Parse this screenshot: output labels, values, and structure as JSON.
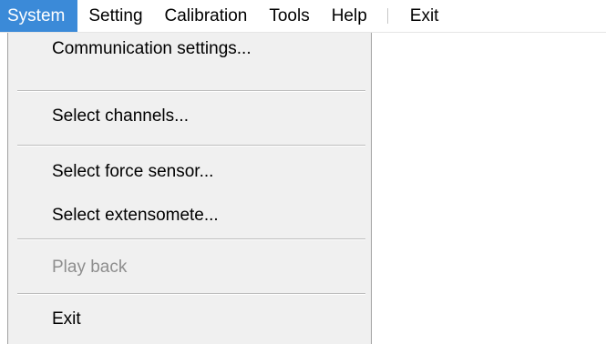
{
  "menubar": {
    "items": [
      {
        "label": "System",
        "active": true
      },
      {
        "label": "Setting"
      },
      {
        "label": "Calibration"
      },
      {
        "label": "Tools"
      },
      {
        "label": "Help"
      }
    ],
    "exit_label": "Exit"
  },
  "system_menu": {
    "items": [
      {
        "label": "Communication settings...",
        "enabled": true
      },
      {
        "label": "Select channels...",
        "enabled": true
      },
      {
        "label": "Select force sensor...",
        "enabled": true
      },
      {
        "label": "Select extensomete...",
        "enabled": true
      },
      {
        "label": "Play back",
        "enabled": false
      },
      {
        "label": "Exit",
        "enabled": true
      }
    ]
  },
  "colors": {
    "menu_highlight": "#3b8ad8",
    "dropdown_background": "#f0f0f0",
    "disabled_text": "#8e8e8e"
  }
}
